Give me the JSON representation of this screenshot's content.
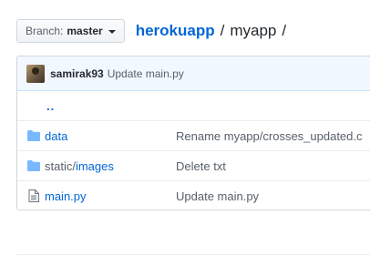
{
  "branch": {
    "label": "Branch:",
    "name": "master"
  },
  "breadcrumb": {
    "root": "herokuapp",
    "separator": "/",
    "dir": "myapp",
    "trailing": "/"
  },
  "commit": {
    "author": "samirak93",
    "message": "Update main.py"
  },
  "parent_link": "..",
  "files": [
    {
      "icon": "folder-icon",
      "name_dir": "",
      "name": "data",
      "message": "Rename myapp/crosses_updated.c"
    },
    {
      "icon": "folder-icon",
      "name_dir": "static/",
      "name": "images",
      "message": "Delete txt"
    },
    {
      "icon": "file-icon",
      "name_dir": "",
      "name": "main.py",
      "message": "Update main.py"
    }
  ],
  "colors": {
    "link": "#0366d6",
    "folder": "#79b8ff",
    "commit_bar_bg": "#f1f8ff"
  }
}
